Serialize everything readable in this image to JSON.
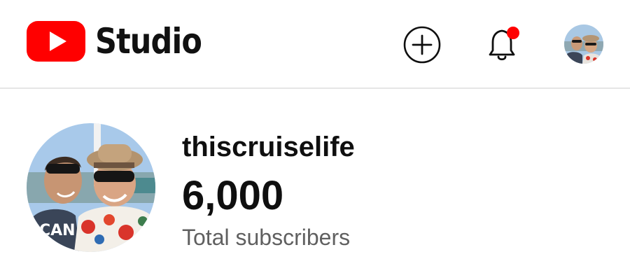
{
  "header": {
    "logo_text": "Studio",
    "brand_color": "#ff0000",
    "notification_dot_color": "#ff0000",
    "icons": {
      "create": "plus-circle-icon",
      "notifications": "bell-icon",
      "account": "account-avatar"
    }
  },
  "channel": {
    "name": "thiscruiselife",
    "subscriber_count": "6,000",
    "subscriber_label": "Total subscribers"
  }
}
